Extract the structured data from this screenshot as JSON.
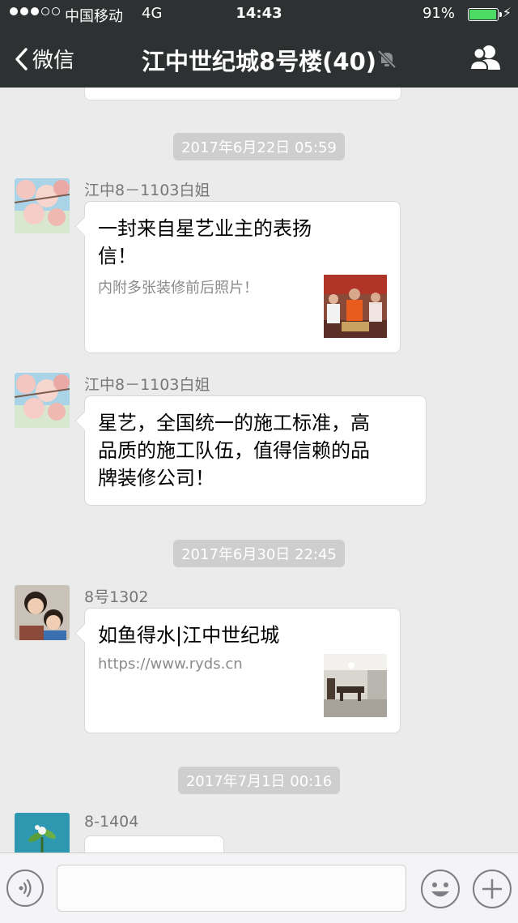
{
  "status": {
    "carrier": "中国移动",
    "network": "4G",
    "time": "14:43",
    "battery": "91%",
    "battery_level": 0.91
  },
  "nav": {
    "back_label": "微信",
    "title": "江中世纪城8号楼(40)"
  },
  "messages": [
    {
      "time": "2017年6月22日 05:59"
    },
    {
      "sender": "江中8－1103白姐",
      "link_title_line1": "一封来自星艺业主的表扬",
      "link_title_line2": "信！",
      "link_desc": "内附多张装修前后照片！",
      "thumb_icon": "group-photo-thumbnail"
    },
    {
      "sender": "江中8－1103白姐",
      "text_line1": "星艺，全国统一的施工标准，高",
      "text_line2": "品质的施工队伍，值得信赖的品",
      "text_line3": "牌装修公司！"
    },
    {
      "time": "2017年6月30日 22:45"
    },
    {
      "sender": "8号1302",
      "link_title": "如鱼得水|江中世纪城",
      "link_desc": "https://www.ryds.cn",
      "thumb_icon": "interior-room-thumbnail"
    },
    {
      "time": "2017年7月1日 00:16"
    },
    {
      "sender": "8-1404"
    }
  ],
  "colors": {
    "header_bg": "#2e3132",
    "chat_bg": "#ebebeb",
    "battery": "#4cd964"
  }
}
